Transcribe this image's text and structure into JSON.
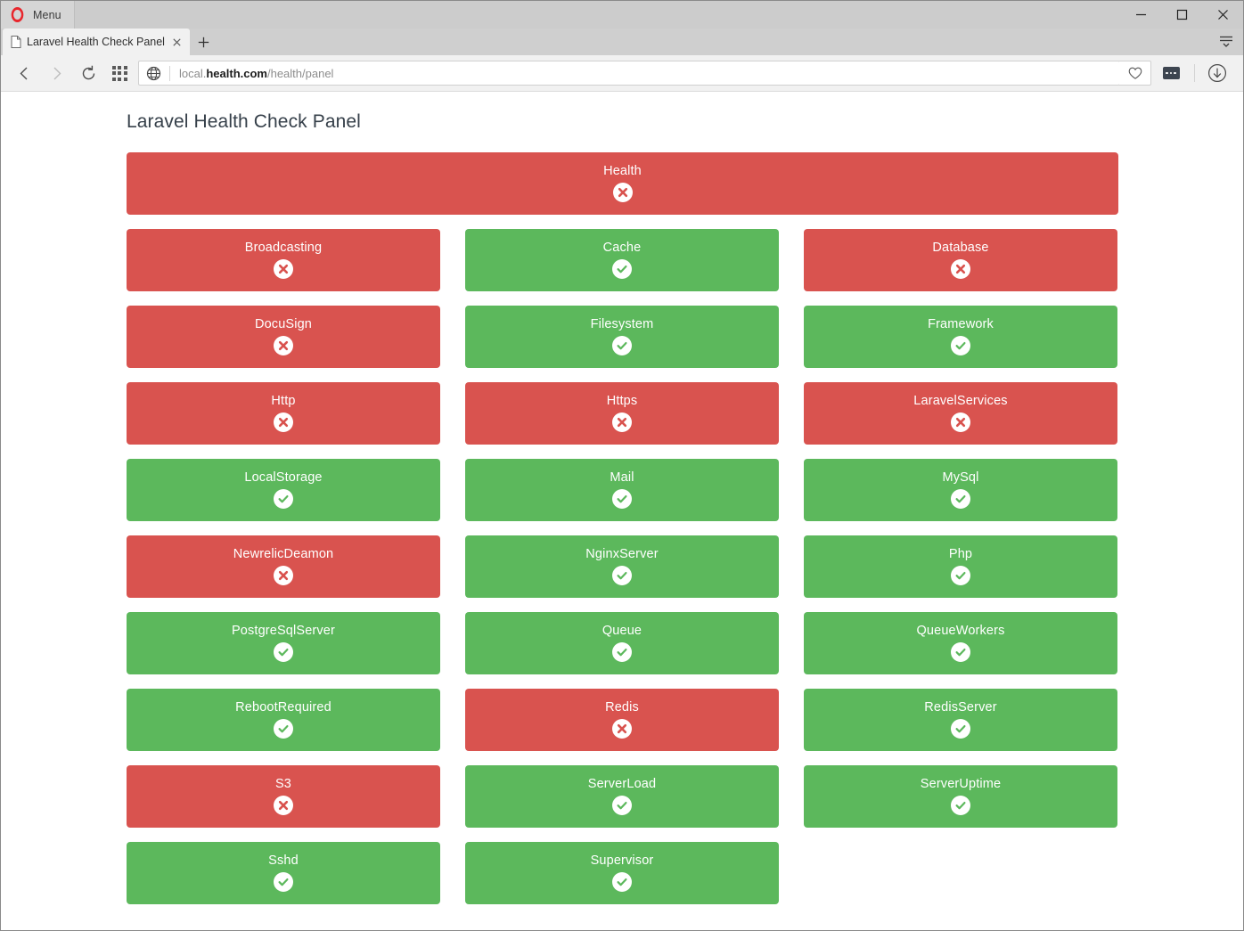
{
  "window": {
    "menu_label": "Menu",
    "minimize_label": "Minimize",
    "maximize_label": "Maximize",
    "close_label": "Close"
  },
  "tabs": [
    {
      "title": "Laravel Health Check Panel",
      "active": true
    }
  ],
  "toolbar": {
    "back_label": "Back",
    "forward_label": "Forward",
    "reload_label": "Reload",
    "speed_dial_label": "Speed Dial",
    "url_prefix": "local.",
    "url_domain": "health.com",
    "url_path": "/health/panel",
    "url_full": "local.health.com/health/panel",
    "heart_label": "Add to bookmarks",
    "extensions_label": "Extensions",
    "downloads_label": "Downloads"
  },
  "page": {
    "title": "Laravel Health Check Panel",
    "colors": {
      "ok": "#5cb85c",
      "fail": "#d9534f",
      "title_text": "#36404a"
    },
    "status_labels": {
      "ok": "ok",
      "fail": "fail"
    },
    "overall": {
      "label": "Health",
      "status": "fail"
    },
    "checks": [
      {
        "label": "Broadcasting",
        "status": "fail"
      },
      {
        "label": "Cache",
        "status": "ok"
      },
      {
        "label": "Database",
        "status": "fail"
      },
      {
        "label": "DocuSign",
        "status": "fail"
      },
      {
        "label": "Filesystem",
        "status": "ok"
      },
      {
        "label": "Framework",
        "status": "ok"
      },
      {
        "label": "Http",
        "status": "fail"
      },
      {
        "label": "Https",
        "status": "fail"
      },
      {
        "label": "LaravelServices",
        "status": "fail"
      },
      {
        "label": "LocalStorage",
        "status": "ok"
      },
      {
        "label": "Mail",
        "status": "ok"
      },
      {
        "label": "MySql",
        "status": "ok"
      },
      {
        "label": "NewrelicDeamon",
        "status": "fail"
      },
      {
        "label": "NginxServer",
        "status": "ok"
      },
      {
        "label": "Php",
        "status": "ok"
      },
      {
        "label": "PostgreSqlServer",
        "status": "ok"
      },
      {
        "label": "Queue",
        "status": "ok"
      },
      {
        "label": "QueueWorkers",
        "status": "ok"
      },
      {
        "label": "RebootRequired",
        "status": "ok"
      },
      {
        "label": "Redis",
        "status": "fail"
      },
      {
        "label": "RedisServer",
        "status": "ok"
      },
      {
        "label": "S3",
        "status": "fail"
      },
      {
        "label": "ServerLoad",
        "status": "ok"
      },
      {
        "label": "ServerUptime",
        "status": "ok"
      },
      {
        "label": "Sshd",
        "status": "ok"
      },
      {
        "label": "Supervisor",
        "status": "ok"
      }
    ]
  }
}
